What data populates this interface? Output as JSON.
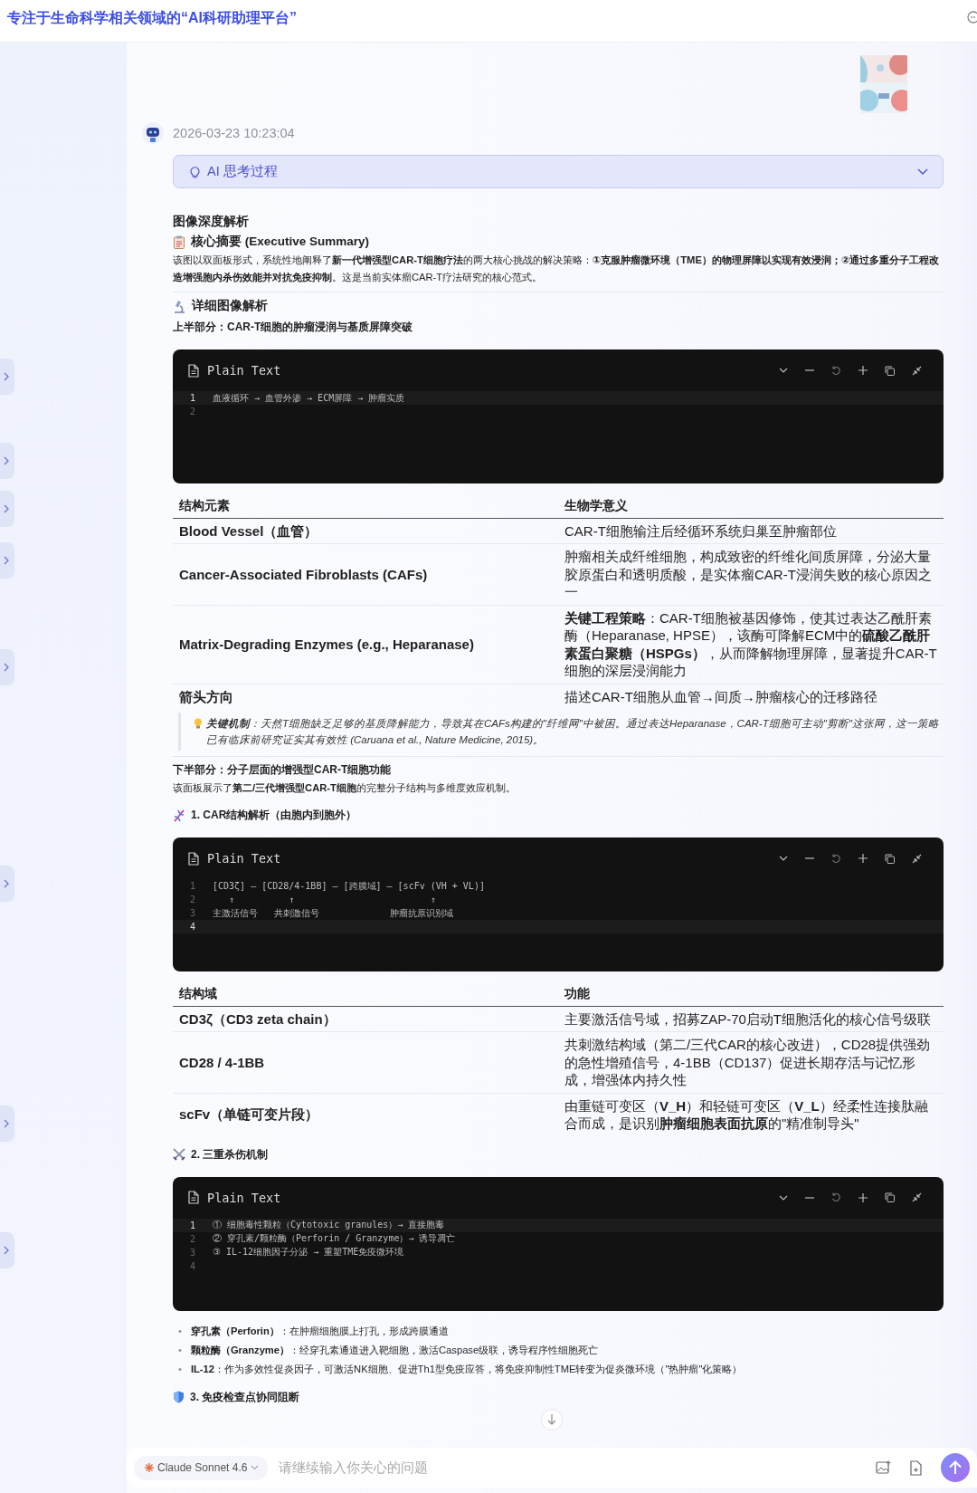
{
  "header": {
    "title": "专注于生命科学相关领域的“AI科研助理平台”"
  },
  "message": {
    "timestamp": "2026-03-23 10:23:04",
    "thinking": {
      "label": "AI 思考过程",
      "expanded": false
    },
    "blocks": [
      {
        "kind": "heading",
        "text": "图像深度解析"
      },
      {
        "kind": "subheading",
        "text": "核心摘要 (Executive Summary)"
      },
      {
        "kind": "paragraph",
        "text": "该图以双面板形式，系统性地阐释了**新一代增强型CAR-T细胞疗法**的两大核心挑战的解决策略：**①克服肿瘤微环境（TME）的物理屏障以实现有效浸润；②通过多重分子工程改造增强胞内杀伤效能并对抗免疫抑制**。这是当前实体瘤CAR-T疗法研究的核心范式。"
      },
      {
        "kind": "divider"
      },
      {
        "kind": "subheading",
        "text": "详细图像解析"
      },
      {
        "kind": "label",
        "text": "上半部分：CAR-T细胞的肿瘤浸润与基质屏障突破"
      },
      {
        "kind": "code",
        "language": "Plain Text",
        "lines": [
          {
            "number": "1",
            "text": "血液循环 → 血管外渗 → ECM屏障 → 肿瘤实质",
            "current": true
          },
          {
            "number": "2",
            "current": false
          }
        ]
      },
      {
        "kind": "table",
        "columns": [
          "结构元素",
          "生物学意义"
        ],
        "rows": [
          [
            "Blood Vessel（血管）",
            "CAR-T细胞输注后经循环系统归巢至肿瘤部位"
          ],
          [
            "Cancer-Associated Fibroblasts (CAFs)",
            "肿瘤相关成纤维细胞，构成致密的纤维化间质屏障，分泌大量胶原蛋白和透明质酸，是实体瘤CAR-T浸润失败的核心原因之一"
          ],
          [
            "Matrix-Degrading Enzymes (e.g., Heparanase)",
            "**关键工程策略**：CAR-T细胞被基因修饰，使其过表达乙酰肝素酶（Heparanase, HPSE），该酶可降解ECM中的**硫酸乙酰肝素蛋白聚糖（HSPGs）**，从而降解物理屏障，显著提升CAR-T细胞的深层浸润能力"
          ],
          [
            "箭头方向",
            "描述CAR-T细胞从血管→间质→肿瘤核心的迁移路径"
          ]
        ]
      },
      {
        "kind": "note",
        "text": "**关键机制**：天然T细胞缺乏足够的基质降解能力，导致其在CAFs构建的\"纤维网\"中被困。通过表达Heparanase，CAR-T细胞可主动\"剪断\"这张网，这一策略已有临床前研究证实其有效性 (Caruana et al., Nature Medicine, 2015)。"
      },
      {
        "kind": "divider"
      },
      {
        "kind": "label",
        "text": "下半部分：分子层面的增强型CAR-T细胞功能"
      },
      {
        "kind": "paragraph",
        "text": "该面板展示了**第二/三代增强型CAR-T细胞**的完整分子结构与多维度效应机制。"
      },
      {
        "kind": "subheading",
        "text": "1. CAR结构解析（由胞内到胞外）"
      },
      {
        "kind": "code",
        "language": "Plain Text",
        "lines": [
          {
            "number": "1",
            "text": "[CD3ζ] — [CD28/4-1BB] — [跨膜域] — [scFv (VH + VL)]",
            "current": false
          },
          {
            "number": "2",
            "text": "   ↑          ↑                         ↑",
            "current": false
          },
          {
            "number": "3",
            "text": "主激活信号   共刺激信号             肿瘤抗原识别域",
            "current": false
          },
          {
            "number": "4",
            "current": true
          }
        ]
      },
      {
        "kind": "table",
        "columns": [
          "结构域",
          "功能"
        ],
        "rows": [
          [
            "CD3ζ（CD3 zeta chain）",
            "主要激活信号域，招募ZAP-70启动T细胞活化的核心信号级联"
          ],
          [
            "CD28 / 4-1BB",
            "共刺激结构域（第二/三代CAR的核心改进），CD28提供强劲的急性增殖信号，4-1BB（CD137）促进长期存活与记忆形成，增强体内持久性"
          ],
          [
            "scFv（单链可变片段）",
            "由重链可变区（**V_H**）和轻链可变区（**V_L**）经柔性连接肽融合而成，是识别**肿瘤细胞表面抗原**的\"精准制导头\""
          ]
        ]
      },
      {
        "kind": "subheading",
        "text": "2. 三重杀伤机制"
      },
      {
        "kind": "code",
        "language": "Plain Text",
        "lines": [
          {
            "number": "1",
            "text": "① 细胞毒性颗粒（Cytotoxic granules）→ 直接胞毒",
            "current": true
          },
          {
            "number": "2",
            "text": "② 穿孔素/颗粒酶（Perforin / Granzyme）→ 诱导凋亡",
            "current": false
          },
          {
            "number": "3",
            "text": "③ IL-12细胞因子分泌 → 重塑TME免疫微环境",
            "current": false
          },
          {
            "number": "4",
            "current": false
          }
        ]
      },
      {
        "kind": "list",
        "items": [
          {
            "marker": "•",
            "text": "**穿孔素（Perforin）**：在肿瘤细胞膜上打孔，形成跨膜通道"
          },
          {
            "marker": "•",
            "text": "**颗粒酶（Granzyme）**：经穿孔素通道进入靶细胞，激活Caspase级联，诱导程序性细胞死亡"
          },
          {
            "marker": "•",
            "text": "**IL-12**：作为多效性促炎因子，可激活NK细胞、促进Th1型免疫应答，将免疫抑制性TME转变为促炎微环境（\"热肿瘤\"化策略）"
          }
        ]
      },
      {
        "kind": "subheading",
        "text": "3. 免疫检查点协同阻断"
      }
    ]
  },
  "composer": {
    "model": "Claude Sonnet 4.6",
    "placeholder": "请继续输入你关心的问题"
  }
}
